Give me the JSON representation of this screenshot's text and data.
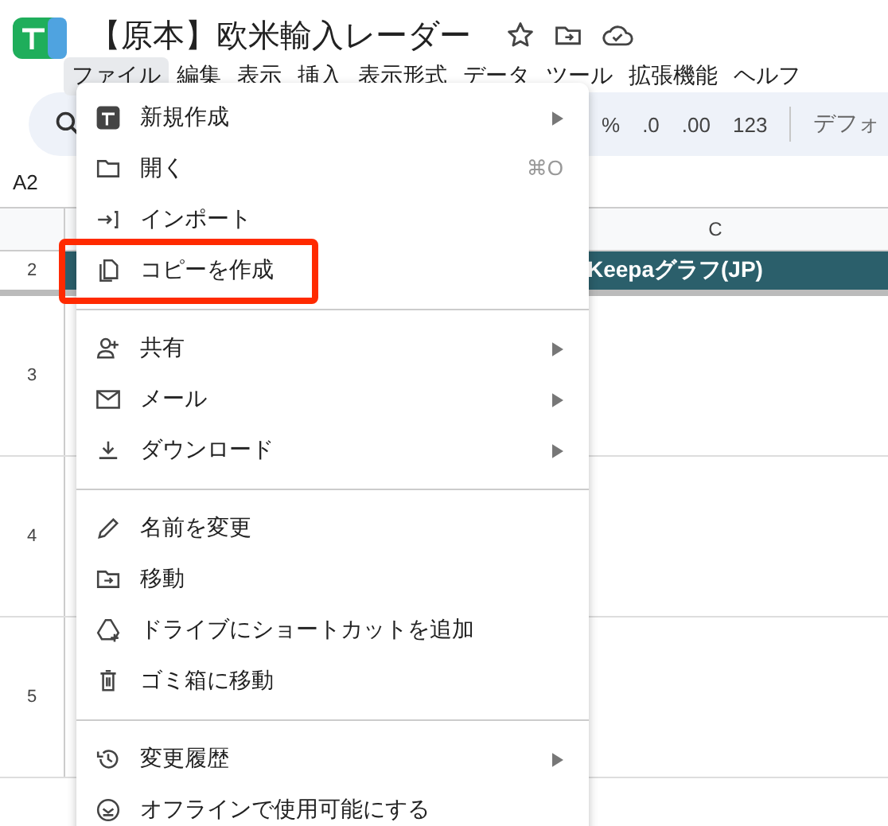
{
  "document": {
    "title": "【原本】欧米輸入レーダー"
  },
  "menubar": [
    {
      "label": "ファイル",
      "selected": true
    },
    {
      "label": "編集",
      "selected": false
    },
    {
      "label": "表示",
      "selected": false
    },
    {
      "label": "挿入",
      "selected": false
    },
    {
      "label": "表示形式",
      "selected": false
    },
    {
      "label": "データ",
      "selected": false
    },
    {
      "label": "ツール",
      "selected": false
    },
    {
      "label": "拡張機能",
      "selected": false
    },
    {
      "label": "ヘルフ",
      "selected": false
    }
  ],
  "toolbar": {
    "items": [
      "%",
      ".0",
      ".00",
      "123"
    ],
    "font": "デフォ"
  },
  "name_box": "A2",
  "sheet": {
    "column_header": "C",
    "rows": [
      {
        "number": "2",
        "cell": "Keepaグラフ(JP)"
      },
      {
        "number": "3",
        "cell": ""
      },
      {
        "number": "4",
        "cell": ""
      },
      {
        "number": "5",
        "cell": ""
      }
    ]
  },
  "file_menu": {
    "groups": [
      [
        {
          "label": "新規作成",
          "submenu": true,
          "highlighted": false
        },
        {
          "label": "開く",
          "shortcut": "⌘O",
          "submenu": false,
          "highlighted": false
        },
        {
          "label": "インポート",
          "submenu": false,
          "highlighted": false
        },
        {
          "label": "コピーを作成",
          "submenu": false,
          "highlighted": true
        }
      ],
      [
        {
          "label": "共有",
          "submenu": true,
          "highlighted": false
        },
        {
          "label": "メール",
          "submenu": true,
          "highlighted": false
        },
        {
          "label": "ダウンロード",
          "submenu": true,
          "highlighted": false
        }
      ],
      [
        {
          "label": "名前を変更",
          "submenu": false,
          "highlighted": false
        },
        {
          "label": "移動",
          "submenu": false,
          "highlighted": false
        },
        {
          "label": "ドライブにショートカットを追加",
          "submenu": false,
          "highlighted": false
        },
        {
          "label": "ゴミ箱に移動",
          "submenu": false,
          "highlighted": false
        }
      ],
      [
        {
          "label": "変更履歴",
          "submenu": true,
          "highlighted": false
        },
        {
          "label": "オフラインで使用可能にする",
          "submenu": false,
          "highlighted": false
        }
      ]
    ]
  }
}
